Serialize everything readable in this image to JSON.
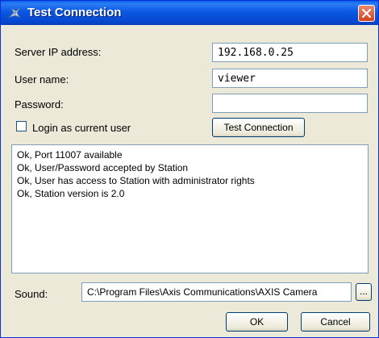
{
  "window": {
    "title": "Test Connection"
  },
  "form": {
    "server_ip_label": "Server IP address:",
    "server_ip_value": "192.168.0.25",
    "username_label": "User name:",
    "username_value": "viewer",
    "password_label": "Password:",
    "password_value": "",
    "login_current_label": "Login as current user",
    "login_current_checked": false,
    "test_button_label": "Test Connection"
  },
  "log": {
    "lines": [
      "Ok, Port 11007 available",
      "Ok, User/Password accepted by Station",
      "Ok, User has access to Station with administrator rights",
      "Ok, Station version is 2.0"
    ]
  },
  "sound": {
    "label": "Sound:",
    "path_value": "C:\\Program Files\\Axis Communications\\AXIS Camera",
    "browse_label": "..."
  },
  "footer": {
    "ok_label": "OK",
    "cancel_label": "Cancel"
  }
}
